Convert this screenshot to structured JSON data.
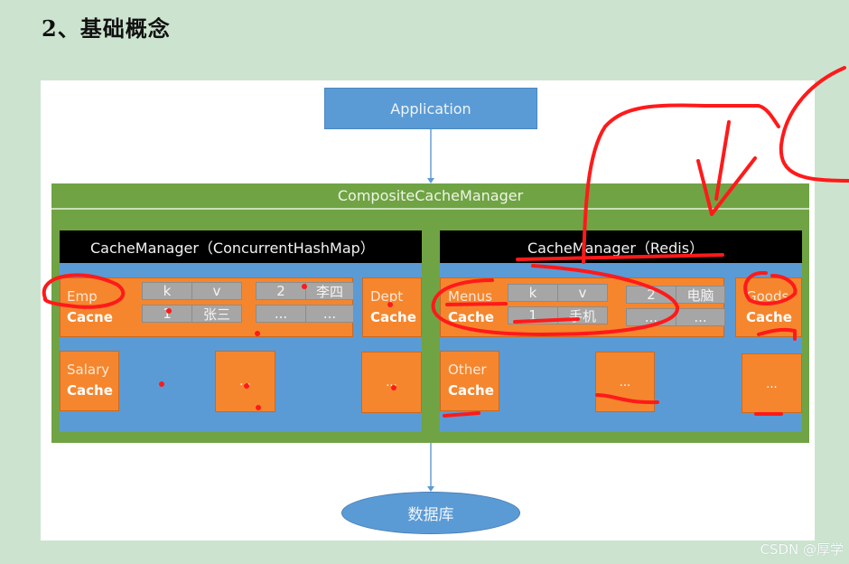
{
  "heading": "2、基础概念",
  "diagram": {
    "application": "Application",
    "composite_manager": "CompositeCacheManager",
    "database": "数据库",
    "left_manager": {
      "title": "CacheManager（ConcurrentHashMap）",
      "caches": [
        {
          "line1": "Emp",
          "line2": "Cacne"
        },
        {
          "line1": "Dept",
          "line2": "Cache"
        },
        {
          "line1": "Salary",
          "line2": "Cache"
        },
        {
          "text": "..."
        },
        {
          "text": "..."
        }
      ],
      "table_a": [
        [
          "k",
          "v"
        ],
        [
          "1",
          "张三"
        ]
      ],
      "table_b": [
        [
          "2",
          "李四"
        ],
        [
          "...",
          "..."
        ]
      ]
    },
    "right_manager": {
      "title": "CacheManager（Redis）",
      "caches": [
        {
          "line1": "Menus",
          "line2": "Cache"
        },
        {
          "line1": "Goods",
          "line2": "Cache"
        },
        {
          "line1": "Other",
          "line2": "Cache"
        },
        {
          "text": "..."
        },
        {
          "text": "..."
        }
      ],
      "table_a": [
        [
          "k",
          "v"
        ],
        [
          "1",
          "手机"
        ]
      ],
      "table_b": [
        [
          "2",
          "电脑"
        ],
        [
          "...",
          "..."
        ]
      ]
    }
  },
  "colors": {
    "background": "#cce4cf",
    "composite_green": "#70a344",
    "manager_blue": "#5b9bd5",
    "cache_orange": "#f5862e",
    "cell_gray": "#a6a6a6",
    "annotation_red": "#ff1a1a"
  },
  "watermark": "CSDN @厚学"
}
